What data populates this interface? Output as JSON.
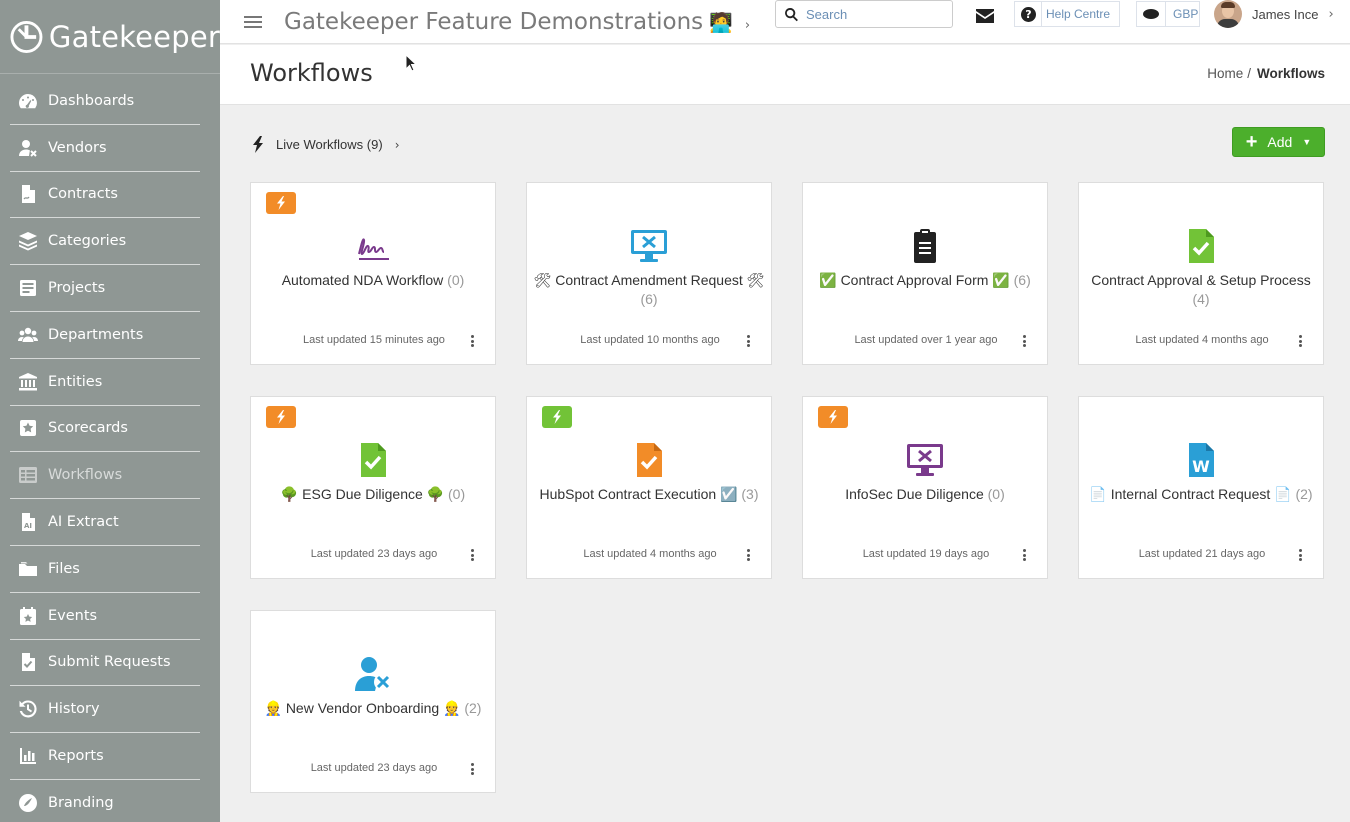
{
  "brand": {
    "name": "Gatekeeper"
  },
  "sidebar": {
    "items": [
      {
        "label": "Dashboards",
        "icon": "dashboard-icon"
      },
      {
        "label": "Vendors",
        "icon": "vendors-icon"
      },
      {
        "label": "Contracts",
        "icon": "contracts-icon"
      },
      {
        "label": "Categories",
        "icon": "categories-icon"
      },
      {
        "label": "Projects",
        "icon": "projects-icon"
      },
      {
        "label": "Departments",
        "icon": "departments-icon"
      },
      {
        "label": "Entities",
        "icon": "entities-icon"
      },
      {
        "label": "Scorecards",
        "icon": "scorecards-icon"
      },
      {
        "label": "Workflows",
        "icon": "workflows-icon",
        "active": true
      },
      {
        "label": "AI Extract",
        "icon": "ai-extract-icon"
      },
      {
        "label": "Files",
        "icon": "files-icon"
      },
      {
        "label": "Events",
        "icon": "events-icon"
      },
      {
        "label": "Submit Requests",
        "icon": "submit-requests-icon"
      },
      {
        "label": "History",
        "icon": "history-icon"
      },
      {
        "label": "Reports",
        "icon": "reports-icon"
      },
      {
        "label": "Branding",
        "icon": "branding-icon"
      }
    ]
  },
  "topbar": {
    "title": "Gatekeeper Feature Demonstrations",
    "title_emoji": "🧑‍💻",
    "search_placeholder": "Search",
    "help_label": "Help Centre",
    "currency": "GBP",
    "user_name": "James Ince"
  },
  "page": {
    "title": "Workflows",
    "breadcrumb_home": "Home",
    "breadcrumb_current": "Workflows"
  },
  "toolbar": {
    "live_workflows_label": "Live Workflows (9)",
    "add_label": "Add"
  },
  "cards": [
    {
      "title": "Automated NDA Workflow",
      "count": "(0)",
      "updated": "Last updated 15 minutes ago",
      "badge": "orange",
      "icon": "signature-icon"
    },
    {
      "title": "🛠 Contract Amendment Request 🛠",
      "count": "(6)",
      "updated": "Last updated 10 months ago",
      "badge": null,
      "icon": "monitor-tools-icon"
    },
    {
      "title": "✅ Contract Approval Form ✅",
      "count": "(6)",
      "updated": "Last updated over 1 year ago",
      "badge": null,
      "icon": "clipboard-icon"
    },
    {
      "title": "Contract Approval & Setup Process",
      "count": "(4)",
      "updated": "Last updated 4 months ago",
      "badge": null,
      "icon": "file-check-icon"
    },
    {
      "title": "🌳 ESG Due Diligence 🌳",
      "count": "(0)",
      "updated": "Last updated 23 days ago",
      "badge": "orange",
      "icon": "file-check-icon"
    },
    {
      "title": "HubSpot Contract Execution ☑️",
      "count": "(3)",
      "updated": "Last updated 4 months ago",
      "badge": "green",
      "icon": "file-check-icon"
    },
    {
      "title": "InfoSec Due Diligence",
      "count": "(0)",
      "updated": "Last updated 19 days ago",
      "badge": "orange",
      "icon": "monitor-tools-icon"
    },
    {
      "title": "📄 Internal Contract Request 📄",
      "count": "(2)",
      "updated": "Last updated 21 days ago",
      "badge": null,
      "icon": "word-file-icon"
    },
    {
      "title": "👷 New Vendor Onboarding 👷",
      "count": "(2)",
      "updated": "Last updated 23 days ago",
      "badge": null,
      "icon": "user-tools-icon"
    }
  ],
  "colors": {
    "sidebar_bg": "#8f9794",
    "accent_green": "#4caf2c",
    "badge_orange": "#f28c28",
    "badge_green": "#72c337",
    "link_blue": "#6b8fb5"
  }
}
